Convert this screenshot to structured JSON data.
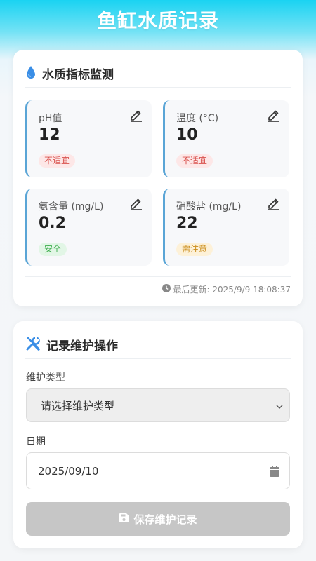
{
  "app": {
    "title": "鱼缸水质记录"
  },
  "water_card": {
    "title": "水质指标监测",
    "metrics": [
      {
        "label": "pH值",
        "value": "12",
        "status": "不适宜"
      },
      {
        "label": "温度 (°C)",
        "value": "10",
        "status": "不适宜"
      },
      {
        "label": "氨含量 (mg/L)",
        "value": "0.2",
        "status": "安全"
      },
      {
        "label": "硝酸盐 (mg/L)",
        "value": "22",
        "status": "需注意"
      }
    ],
    "last_updated": "最后更新: 2025/9/9 18:08:37"
  },
  "maintenance_card": {
    "title": "记录维护操作",
    "type_label": "维护类型",
    "type_placeholder": "请选择维护类型",
    "date_label": "日期",
    "date_value": "2025/09/10",
    "save_label": "保存维护记录"
  },
  "colors": {
    "accent": "#5aa5d6",
    "header_gradient_top": "#1ad3f2",
    "status_bad": "#d9534f",
    "status_ok": "#3fae4f",
    "status_warn": "#c98a16",
    "icon_blue": "#3a8ee6",
    "button_disabled": "#c6c6c6"
  },
  "icons": [
    "water-drop-icon",
    "edit-icon",
    "clock-icon",
    "tools-icon",
    "chevron-down-icon",
    "calendar-icon",
    "save-icon"
  ]
}
